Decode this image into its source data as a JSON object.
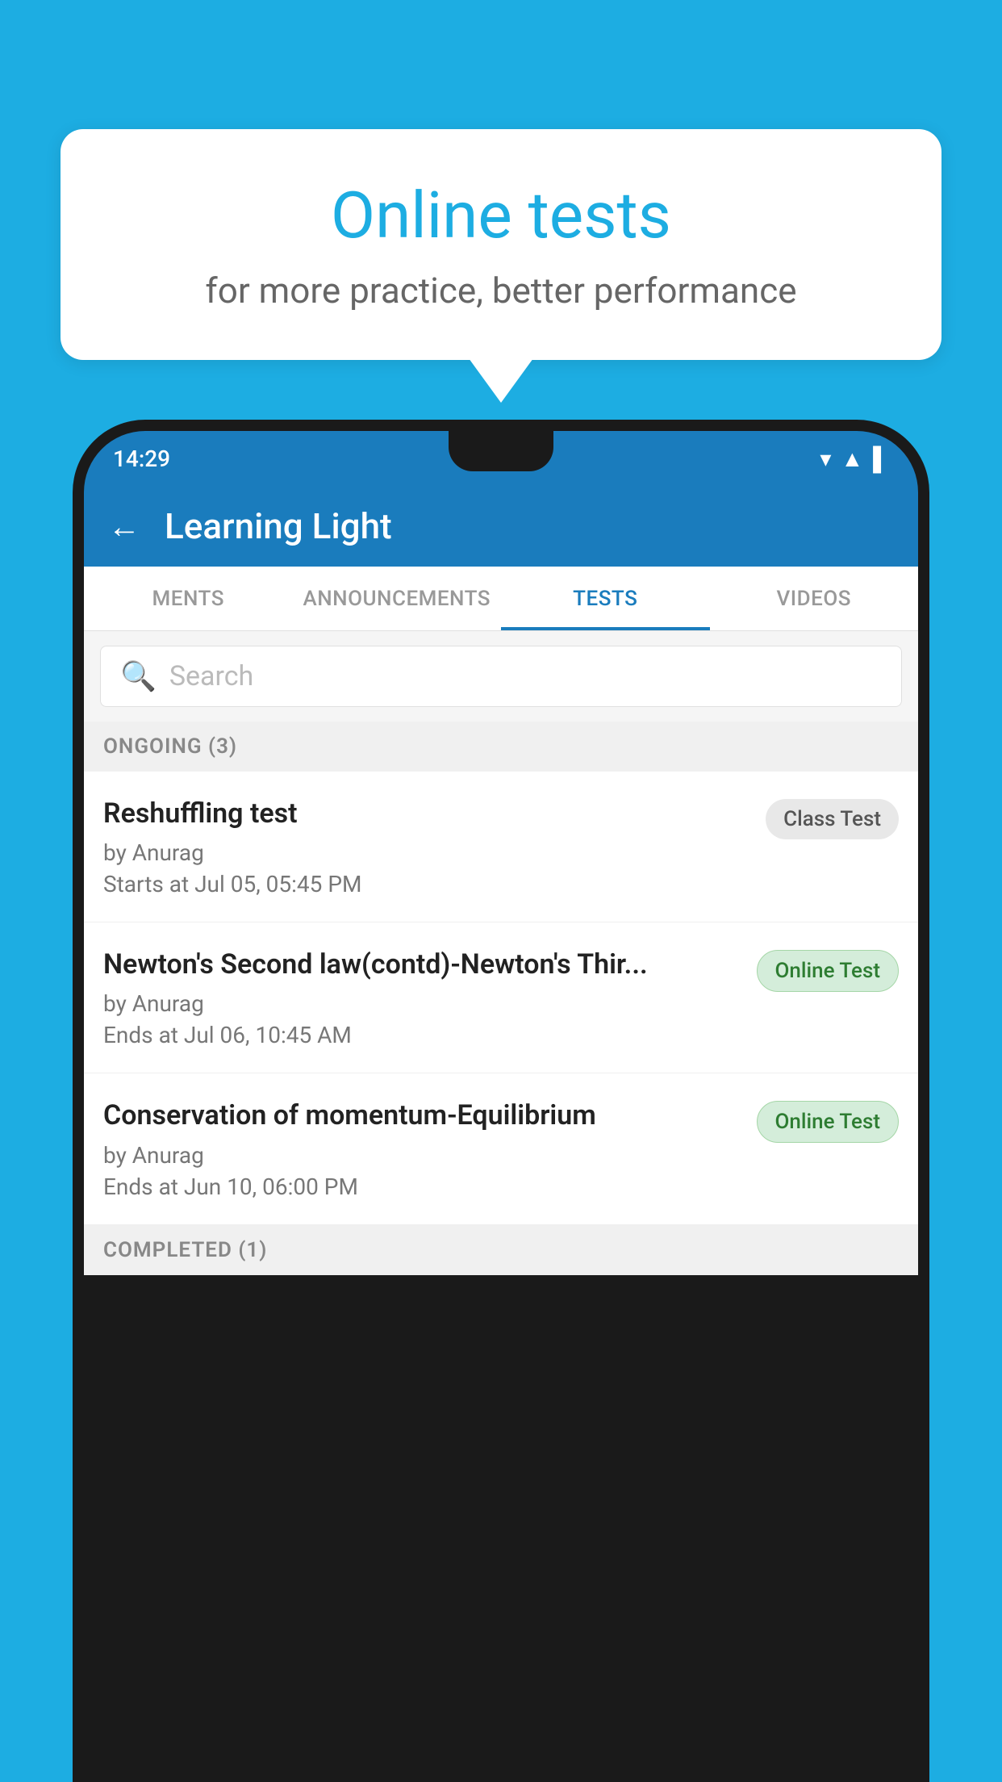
{
  "background": {
    "color": "#1DADE2"
  },
  "speech_bubble": {
    "title": "Online tests",
    "subtitle": "for more practice, better performance"
  },
  "phone": {
    "status_bar": {
      "time": "14:29"
    },
    "app_bar": {
      "title": "Learning Light",
      "back_label": "←"
    },
    "tabs": [
      {
        "label": "MENTS",
        "active": false
      },
      {
        "label": "ANNOUNCEMENTS",
        "active": false
      },
      {
        "label": "TESTS",
        "active": true
      },
      {
        "label": "VIDEOS",
        "active": false
      }
    ],
    "search": {
      "placeholder": "Search"
    },
    "ongoing_section": {
      "title": "ONGOING (3)"
    },
    "tests": [
      {
        "name": "Reshuffling test",
        "author": "by Anurag",
        "date": "Starts at  Jul 05, 05:45 PM",
        "badge": "Class Test",
        "badge_type": "class"
      },
      {
        "name": "Newton's Second law(contd)-Newton's Thir...",
        "author": "by Anurag",
        "date": "Ends at  Jul 06, 10:45 AM",
        "badge": "Online Test",
        "badge_type": "online"
      },
      {
        "name": "Conservation of momentum-Equilibrium",
        "author": "by Anurag",
        "date": "Ends at  Jun 10, 06:00 PM",
        "badge": "Online Test",
        "badge_type": "online"
      }
    ],
    "completed_section": {
      "title": "COMPLETED (1)"
    }
  }
}
